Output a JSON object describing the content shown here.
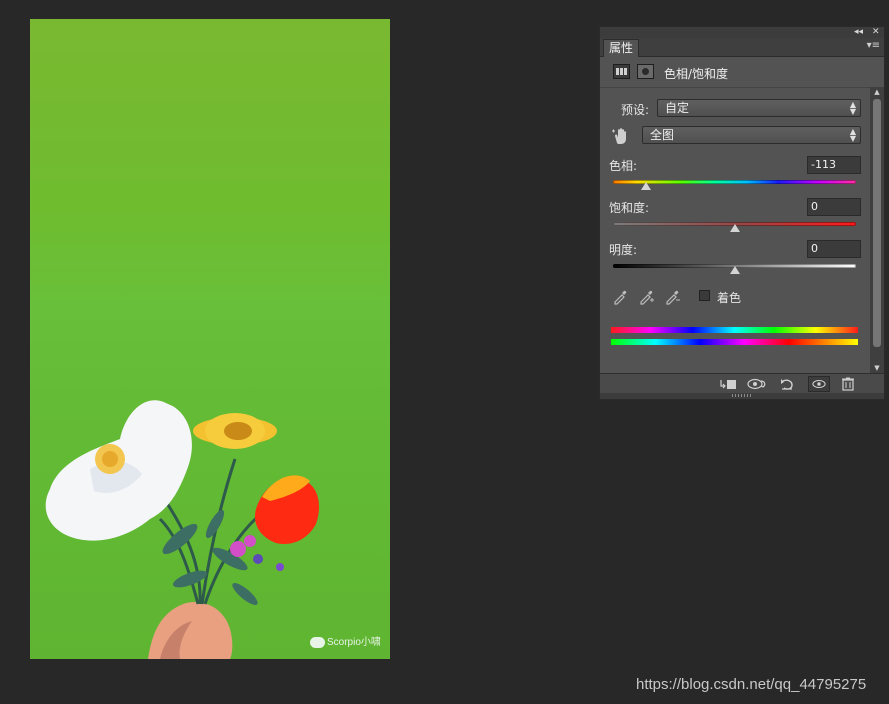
{
  "panel": {
    "tab_label": "属性",
    "adjustment_title": "色相/饱和度",
    "preset": {
      "label": "预设:",
      "value": "自定"
    },
    "channel": {
      "value": "全图"
    },
    "hue": {
      "label": "色相:",
      "value": "-113"
    },
    "saturation": {
      "label": "饱和度:",
      "value": "0"
    },
    "lightness": {
      "label": "明度:",
      "value": "0"
    },
    "colorize": {
      "label": "着色",
      "checked": false
    },
    "hue_slider_level": -113,
    "saturation_slider_level": 0,
    "lightness_slider_level": 0,
    "icons": {
      "collapse": "double-chevron-left-icon",
      "close": "close-icon",
      "menu": "panel-menu-icon",
      "adjustment": "hue-saturation-icon",
      "mask": "mask-icon",
      "target": "hand-target-icon",
      "eyedroppers": [
        "eyedropper-icon",
        "eyedropper-plus-icon",
        "eyedropper-minus-icon"
      ],
      "footer": [
        "clip-to-layer-icon",
        "view-previous-state-icon",
        "reset-icon",
        "visibility-eye-icon",
        "trash-icon"
      ]
    }
  },
  "canvas": {
    "watermark": "Scorpio小啸"
  },
  "page_watermark": "https://blog.csdn.net/qq_44795275",
  "colors": {
    "workspace_bg": "#282828",
    "panel_bg": "#535353",
    "canvas_green": "#6fbc2f"
  }
}
